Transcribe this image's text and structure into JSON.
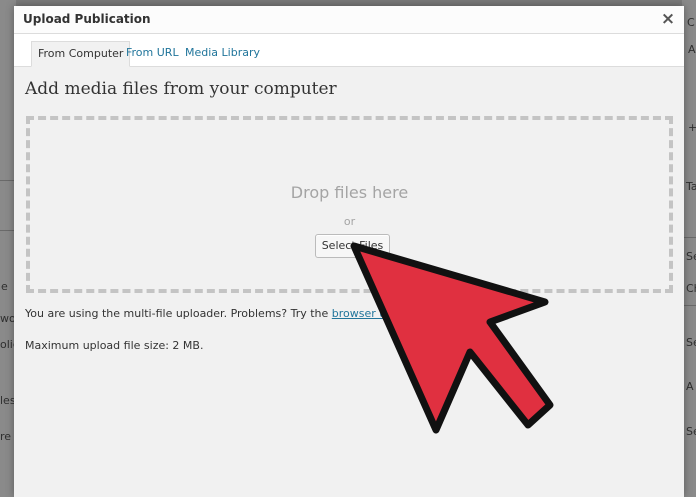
{
  "modal": {
    "title": "Upload Publication",
    "close_glyph": "×"
  },
  "tabs": [
    {
      "label": "From Computer",
      "active": true
    },
    {
      "label": "From URL",
      "active": false
    },
    {
      "label": "Media Library",
      "active": false
    }
  ],
  "content": {
    "heading": "Add media files from your computer",
    "drop_text": "Drop files here",
    "or_text": "or",
    "select_button": "Select Files",
    "uploader_text": "You are using the multi-file uploader. Problems? Try the ",
    "browser_link": "browser uploader",
    "max_size": "Maximum upload file size: 2 MB."
  },
  "background_fragments": {
    "right": [
      "C",
      "A",
      "+",
      "Ta",
      "Se",
      "Ch",
      "Se",
      "A",
      "Se"
    ],
    "left": [
      "e",
      "wo",
      "olic",
      "les",
      "re"
    ]
  },
  "colors": {
    "link": "#21759b",
    "arrow_fill": "#e03040",
    "arrow_stroke": "#111111",
    "dropzone_border": "#c4c4c4"
  },
  "icons": {
    "close": "close-icon",
    "pointer": "red-arrow-pointer-icon"
  }
}
